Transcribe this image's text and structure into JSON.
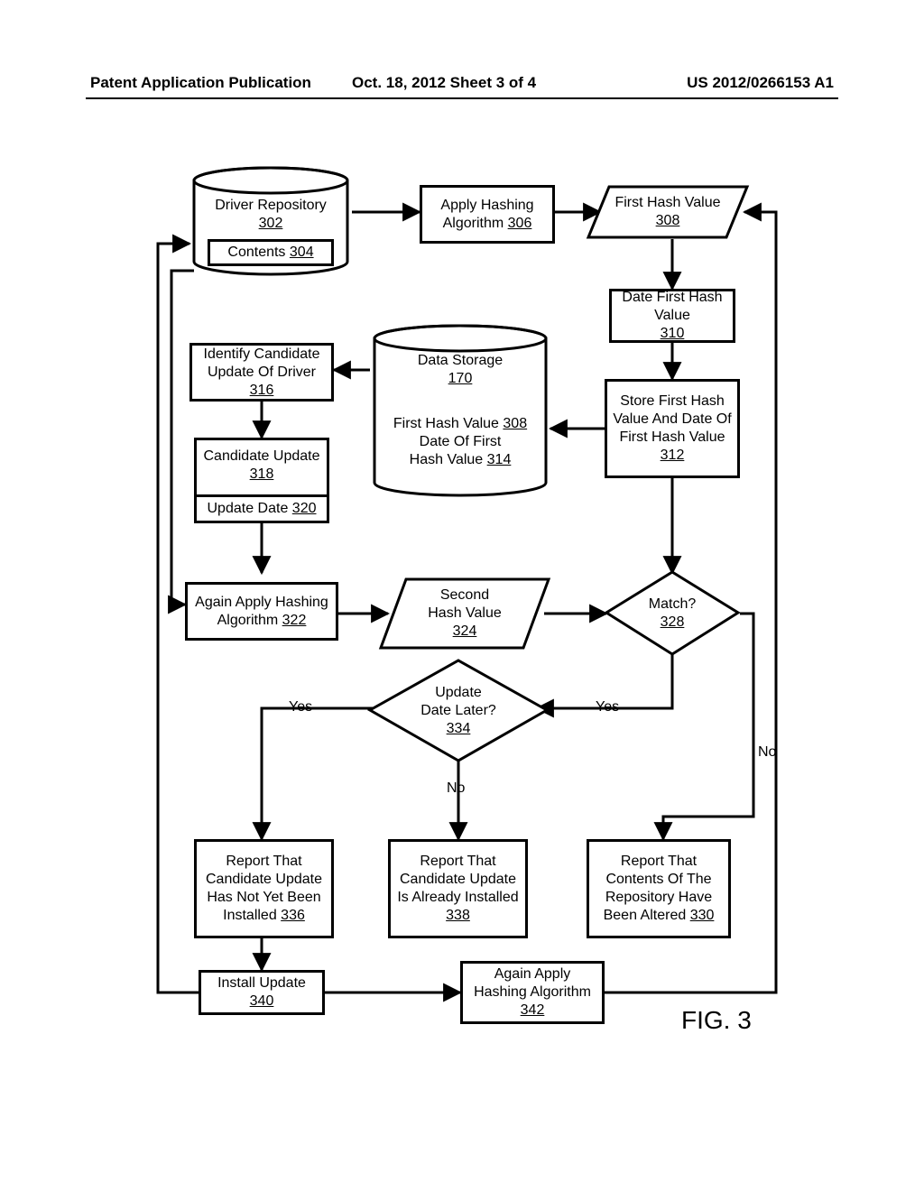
{
  "header": {
    "left": "Patent Application Publication",
    "mid": "Oct. 18, 2012  Sheet 3 of 4",
    "right": "US 2012/0266153 A1"
  },
  "figure_label": "FIG. 3",
  "edges": {
    "yes_left": "Yes",
    "yes_right": "Yes",
    "no_right": "No",
    "no_bottom": "No"
  },
  "nodes": {
    "driver_repo": {
      "title": "Driver Repository",
      "ref": "302"
    },
    "contents": {
      "title": "Contents",
      "ref": "304"
    },
    "apply_hash": {
      "title": "Apply Hashing Algorithm",
      "ref": "306"
    },
    "first_hash": {
      "title": "First Hash Value",
      "ref": "308"
    },
    "date_first_hash": {
      "title": "Date First Hash Value",
      "ref": "310"
    },
    "store_first_hash": {
      "title": "Store First Hash Value And Date Of First Hash Value",
      "ref": "312"
    },
    "data_storage": {
      "title": "Data Storage",
      "ref": "170",
      "line1": "First Hash Value",
      "line1ref": "308",
      "line2a": "Date Of First",
      "line2b": "Hash Value",
      "line2ref": "314"
    },
    "identify_cand": {
      "title": "Identify Candidate Update Of Driver",
      "ref": "316"
    },
    "candidate_update": {
      "title": "Candidate Update",
      "ref": "318"
    },
    "update_date": {
      "title": "Update Date",
      "ref": "320"
    },
    "again_apply": {
      "title": "Again Apply Hashing Algorithm",
      "ref": "322"
    },
    "second_hash": {
      "title": "Second Hash Value",
      "ref": "324"
    },
    "match": {
      "title": "Match?",
      "ref": "328"
    },
    "update_later": {
      "title": "Update Date Later?",
      "ref": "334"
    },
    "report_notyet": {
      "title": "Report That Candidate Update Has Not Yet Been Installed",
      "ref": "336"
    },
    "report_already": {
      "title": "Report That Candidate Update Is Already Installed",
      "ref": "338"
    },
    "report_altered": {
      "title": "Report That Contents Of The Repository Have Been Altered",
      "ref": "330"
    },
    "install_update": {
      "title": "Install Update",
      "ref": "340"
    },
    "again_apply2": {
      "title": "Again Apply Hashing Algorithm",
      "ref": "342"
    }
  }
}
